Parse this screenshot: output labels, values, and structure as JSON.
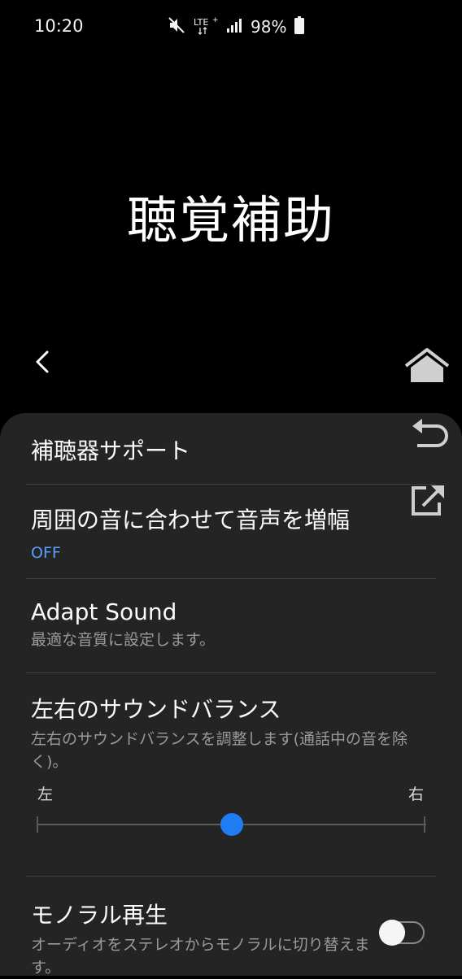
{
  "status_bar": {
    "time": "10:20",
    "network": "LTE+",
    "battery": "98%",
    "icons": [
      "mute-icon",
      "lte-icon",
      "signal-icon",
      "battery-icon"
    ]
  },
  "header": {
    "title": "聴覚補助"
  },
  "colors": {
    "background": "#000000",
    "panel": "#242424",
    "accent": "#1f7cf5",
    "off_text": "#5b9cff",
    "subtitle": "#9a9a9a"
  },
  "settings": {
    "hearing_aid_support": {
      "title": "補聴器サポート"
    },
    "ambient_sound": {
      "title": "周囲の音に合わせて音声を増幅",
      "status": "OFF"
    },
    "adapt_sound": {
      "title": "Adapt Sound",
      "subtitle": "最適な音質に設定します。"
    },
    "sound_balance": {
      "title": "左右のサウンドバランス",
      "subtitle": "左右のサウンドバランスを調整します(通話中の音を除く)。",
      "left_label": "左",
      "right_label": "右",
      "value": 0.5
    },
    "mono_audio": {
      "title": "モノラル再生",
      "subtitle": "オーディオをステレオからモノラルに切り替えます。",
      "enabled": false
    }
  }
}
